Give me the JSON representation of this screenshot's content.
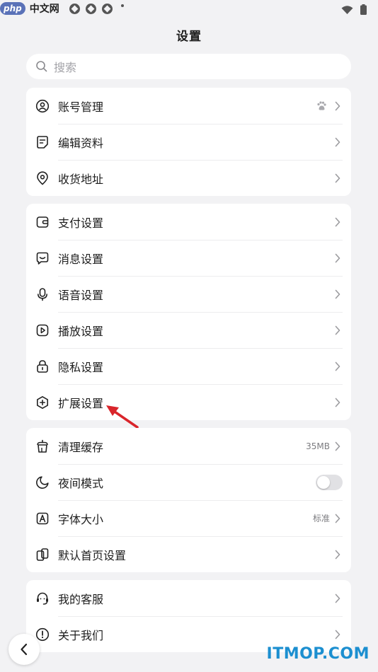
{
  "watermark_top": {
    "logo": "php",
    "text": "中文网"
  },
  "header": {
    "title": "设置"
  },
  "search": {
    "placeholder": "搜索"
  },
  "groups": [
    {
      "items": [
        {
          "label": "账号管理",
          "icon": "person-circle-icon",
          "badge_icon": "paw-icon"
        },
        {
          "label": "编辑资料",
          "icon": "edit-profile-icon"
        },
        {
          "label": "收货地址",
          "icon": "location-pin-icon"
        }
      ]
    },
    {
      "items": [
        {
          "label": "支付设置",
          "icon": "wallet-icon"
        },
        {
          "label": "消息设置",
          "icon": "message-icon"
        },
        {
          "label": "语音设置",
          "icon": "microphone-icon"
        },
        {
          "label": "播放设置",
          "icon": "play-icon"
        },
        {
          "label": "隐私设置",
          "icon": "lock-icon"
        },
        {
          "label": "扩展设置",
          "icon": "plus-hexagon-icon"
        }
      ]
    },
    {
      "items": [
        {
          "label": "清理缓存",
          "icon": "broom-icon",
          "value": "35MB"
        },
        {
          "label": "夜间模式",
          "icon": "moon-icon",
          "toggle": false
        },
        {
          "label": "字体大小",
          "icon": "font-size-icon",
          "value": "标准"
        },
        {
          "label": "默认首页设置",
          "icon": "homepage-icon"
        }
      ]
    },
    {
      "items": [
        {
          "label": "我的客服",
          "icon": "headset-icon"
        },
        {
          "label": "关于我们",
          "icon": "info-icon"
        }
      ]
    }
  ],
  "watermark": "ITMOP.COM",
  "colors": {
    "background": "#f2f2f4",
    "card": "#ffffff",
    "annotation_arrow": "#d9252b",
    "watermark": "#1c8fd0"
  }
}
